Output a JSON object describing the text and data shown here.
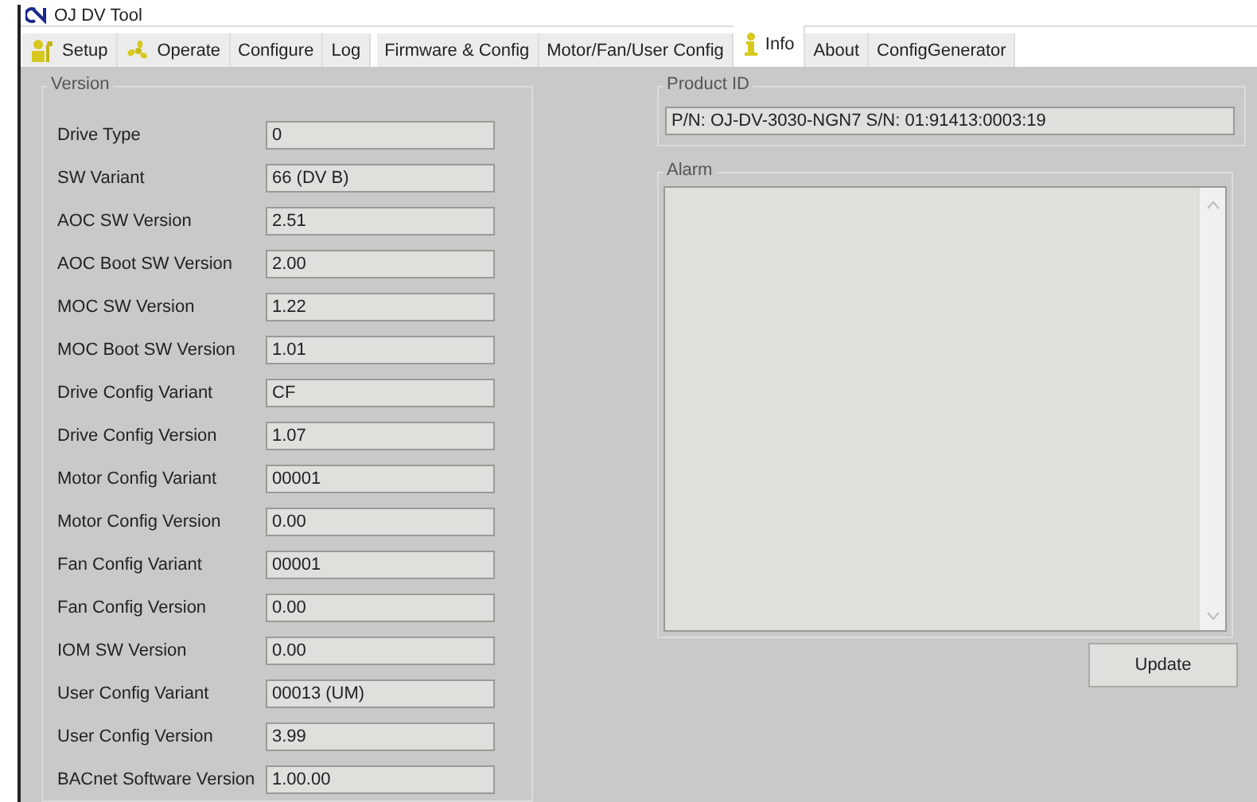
{
  "window": {
    "title": "OJ DV Tool"
  },
  "tabs": [
    {
      "label": "Setup",
      "kind": "setup",
      "selected": false
    },
    {
      "label": "Operate",
      "kind": "operate",
      "selected": false
    },
    {
      "label": "Configure",
      "kind": "plain",
      "selected": false
    },
    {
      "label": "Log",
      "kind": "plain",
      "selected": false
    },
    {
      "label": "Firmware & Config",
      "kind": "plain",
      "selected": false
    },
    {
      "label": "Motor/Fan/User Config",
      "kind": "plain",
      "selected": false
    },
    {
      "label": "Info",
      "kind": "info",
      "selected": true
    },
    {
      "label": "About",
      "kind": "plain",
      "selected": false
    },
    {
      "label": "ConfigGenerator",
      "kind": "plain",
      "selected": false
    }
  ],
  "version": {
    "title": "Version",
    "rows": [
      {
        "label": "Drive Type",
        "value": "0"
      },
      {
        "label": "SW Variant",
        "value": "66 (DV B)"
      },
      {
        "label": "AOC SW Version",
        "value": "2.51"
      },
      {
        "label": "AOC Boot SW Version",
        "value": "2.00"
      },
      {
        "label": "MOC SW Version",
        "value": "1.22"
      },
      {
        "label": "MOC Boot SW Version",
        "value": "1.01"
      },
      {
        "label": "Drive Config Variant",
        "value": "CF"
      },
      {
        "label": "Drive Config Version",
        "value": "1.07"
      },
      {
        "label": "Motor Config Variant",
        "value": "00001"
      },
      {
        "label": "Motor Config Version",
        "value": "0.00"
      },
      {
        "label": "Fan Config Variant",
        "value": "00001"
      },
      {
        "label": "Fan Config Version",
        "value": "0.00"
      },
      {
        "label": "IOM SW Version",
        "value": "0.00"
      },
      {
        "label": "User Config Variant",
        "value": "00013 (UM)"
      },
      {
        "label": "User Config Version",
        "value": "3.99"
      },
      {
        "label": "BACnet Software Version",
        "value": "1.00.00"
      }
    ]
  },
  "product_id": {
    "title": "Product ID",
    "value": "P/N: OJ-DV-3030-NGN7  S/N: 01:91413:0003:19"
  },
  "alarm": {
    "title": "Alarm"
  },
  "buttons": [
    "Update"
  ]
}
